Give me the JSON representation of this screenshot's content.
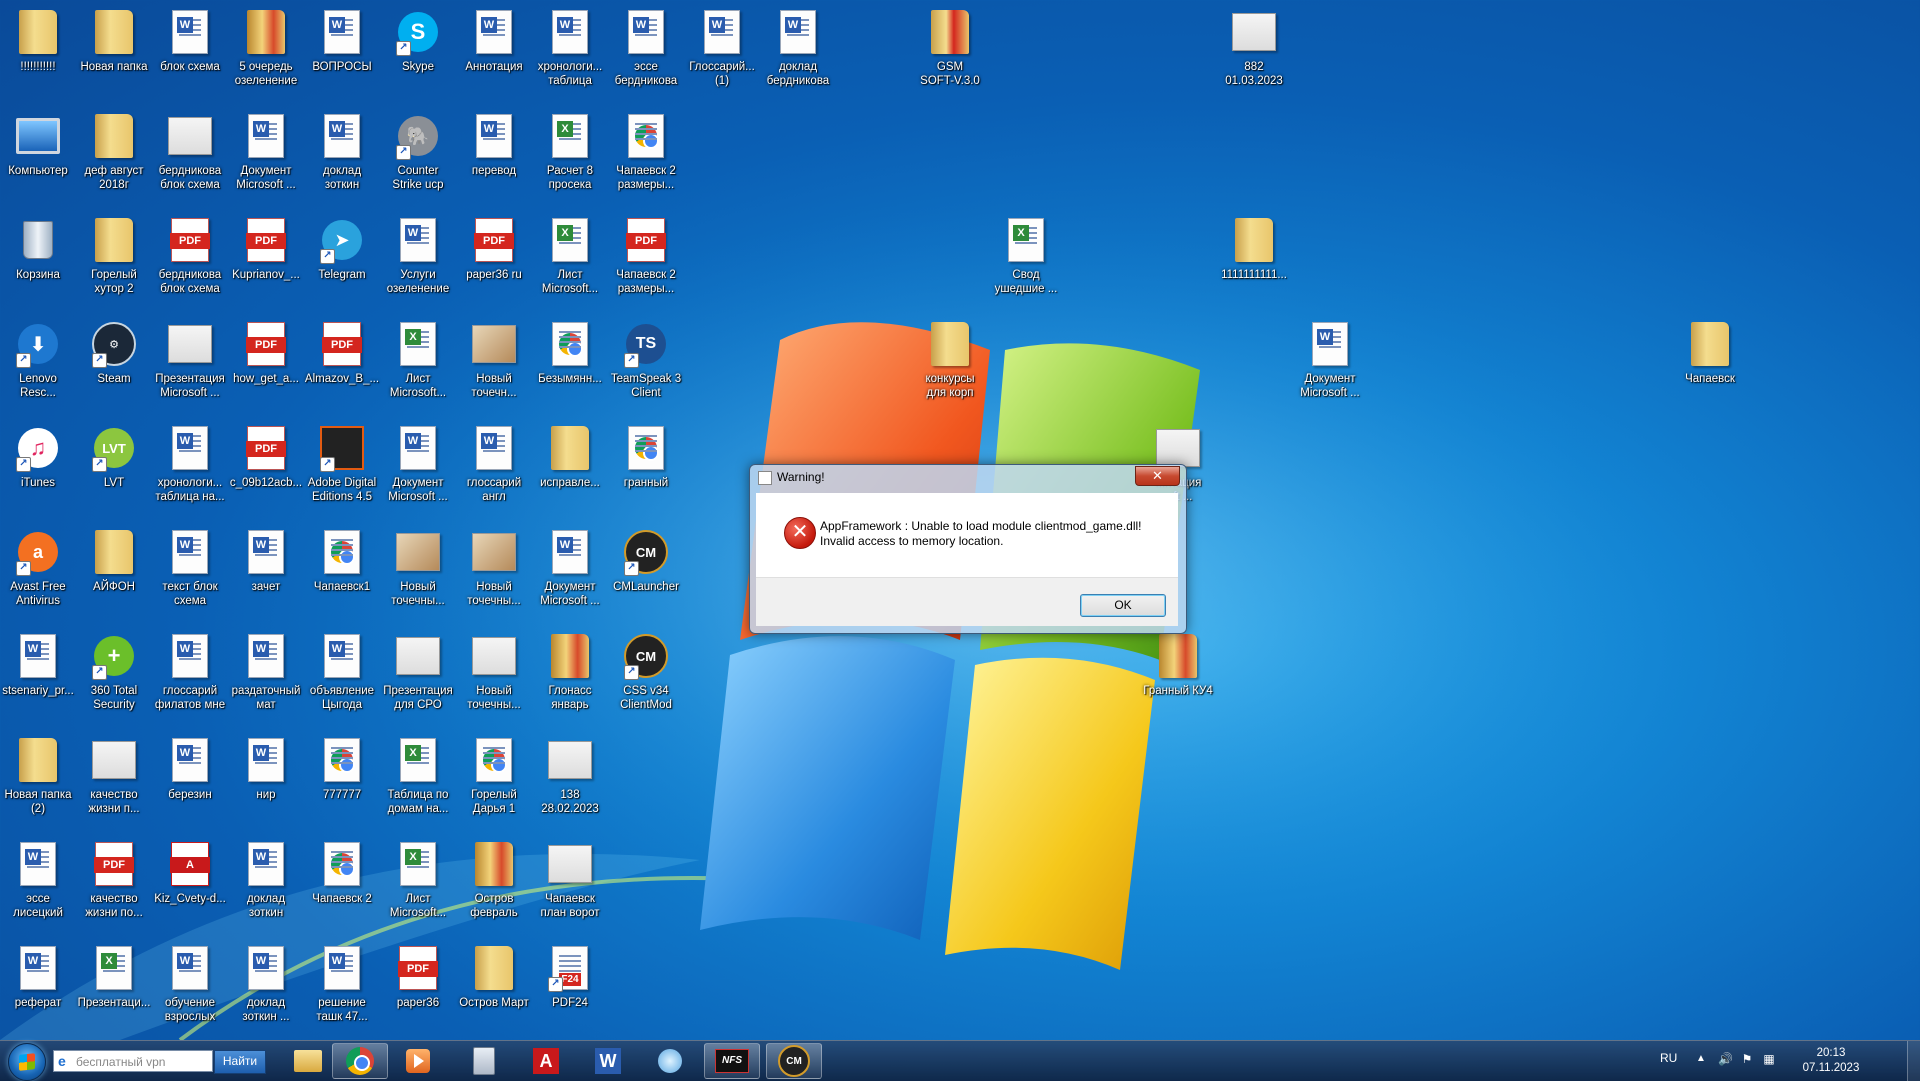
{
  "desktop": {
    "icons": [
      {
        "label": "!!!!!!!!!!!",
        "type": "folder"
      },
      {
        "label": "Новая папка",
        "type": "folder"
      },
      {
        "label": "блок схема",
        "type": "word"
      },
      {
        "label": "5 очередь\nозеленение",
        "type": "folder-red"
      },
      {
        "label": "ВОПРОСЫ",
        "type": "word"
      },
      {
        "label": "Skype",
        "type": "skype"
      },
      {
        "label": "Аннотация",
        "type": "word"
      },
      {
        "label": "хронологи...\nтаблица",
        "type": "word"
      },
      {
        "label": "эссе\nбердникова",
        "type": "word"
      },
      {
        "label": "Глоссарий...\n(1)",
        "type": "word"
      },
      {
        "label": "доклад\nбердникова",
        "type": "word"
      },
      {
        "label": "GSM\nSOFT-V.3.0",
        "type": "pdf-folder"
      },
      {
        "label": "882\n01.03.2023",
        "type": "image"
      },
      {
        "label": "Компьютер",
        "type": "computer"
      },
      {
        "label": "деф август\n2018г",
        "type": "folder"
      },
      {
        "label": "бердникова\nблок схема",
        "type": "image"
      },
      {
        "label": "Документ\nMicrosoft ...",
        "type": "word"
      },
      {
        "label": "доклад\nзоткин",
        "type": "word"
      },
      {
        "label": "Counter\nStrike ucp",
        "type": "elephant"
      },
      {
        "label": "перевод",
        "type": "word"
      },
      {
        "label": "Расчет 8\nпросека",
        "type": "excel"
      },
      {
        "label": "Чапаевск 2\nразмеры...",
        "type": "chrome"
      },
      {
        "label": "Корзина",
        "type": "bin"
      },
      {
        "label": "Горелый\nхутор 2",
        "type": "folder"
      },
      {
        "label": "бердникова\nблок схема",
        "type": "pdf"
      },
      {
        "label": "Kuprianov_...",
        "type": "pdf"
      },
      {
        "label": "Telegram",
        "type": "telegram"
      },
      {
        "label": "Услуги\nозеленение",
        "type": "word"
      },
      {
        "label": "paper36 ru",
        "type": "pdf"
      },
      {
        "label": "Лист\nMicrosoft...",
        "type": "excel"
      },
      {
        "label": "Чапаевск 2\nразмеры...",
        "type": "pdf"
      },
      {
        "label": "Свод\nушедшие ...",
        "type": "excel"
      },
      {
        "label": "1111111111...",
        "type": "folder"
      },
      {
        "label": "Lenovo\nResc...",
        "type": "lenovo"
      },
      {
        "label": "Steam",
        "type": "steam"
      },
      {
        "label": "Презентация\nMicrosoft ...",
        "type": "image"
      },
      {
        "label": "how_get_a...",
        "type": "pdf"
      },
      {
        "label": "Almazov_B_...",
        "type": "pdf"
      },
      {
        "label": "Лист\nMicrosoft...",
        "type": "excel"
      },
      {
        "label": "Новый\nточечн...",
        "type": "paint"
      },
      {
        "label": "Безымянн...",
        "type": "chrome"
      },
      {
        "label": "TeamSpeak 3\nClient",
        "type": "teamspeak"
      },
      {
        "label": "конкурсы\nдля корп",
        "type": "folder"
      },
      {
        "label": "Документ\nMicrosoft ...",
        "type": "word"
      },
      {
        "label": "Чапаевск",
        "type": "folder"
      },
      {
        "label": "iTunes",
        "type": "itunes"
      },
      {
        "label": "LVT",
        "type": "lvt"
      },
      {
        "label": "хронологи...\nтаблица на...",
        "type": "word"
      },
      {
        "label": "c_09b12acb...",
        "type": "pdf"
      },
      {
        "label": "Adobe Digital\nEditions 4.5",
        "type": "ade"
      },
      {
        "label": "Документ\nMicrosoft ...",
        "type": "word"
      },
      {
        "label": "глоссарий\nангл",
        "type": "word"
      },
      {
        "label": "исправле...",
        "type": "folder"
      },
      {
        "label": "гранный",
        "type": "chrome"
      },
      {
        "label": "...нтация\n...ft ...",
        "type": "image"
      },
      {
        "label": "Avast Free\nAntivirus",
        "type": "avast"
      },
      {
        "label": "АЙФОН",
        "type": "folder"
      },
      {
        "label": "текст блок\nсхема",
        "type": "word"
      },
      {
        "label": "зачет",
        "type": "word"
      },
      {
        "label": "Чапаевск1",
        "type": "chrome"
      },
      {
        "label": "Новый\nточечны...",
        "type": "paint"
      },
      {
        "label": "Новый\nточечны...",
        "type": "paint"
      },
      {
        "label": "Документ\nMicrosoft ...",
        "type": "word"
      },
      {
        "label": "CMLauncher",
        "type": "cm"
      },
      {
        "label": "stsenariy_pr...",
        "type": "word"
      },
      {
        "label": "360 Total\nSecurity",
        "type": "360"
      },
      {
        "label": "глоссарий\nфилатов мне",
        "type": "word"
      },
      {
        "label": "раздаточный\nмат",
        "type": "word"
      },
      {
        "label": "объявление\nЦыгода",
        "type": "word"
      },
      {
        "label": "Презентация\nдля СРО",
        "type": "image"
      },
      {
        "label": "Новый\nточечны...",
        "type": "image"
      },
      {
        "label": "Глонасс\nянварь",
        "type": "folder-red"
      },
      {
        "label": "CSS v34\nClientMod",
        "type": "cm"
      },
      {
        "label": "Гранный КУ4",
        "type": "folder-red"
      },
      {
        "label": "Новая папка\n(2)",
        "type": "folder"
      },
      {
        "label": "качество\nжизни п...",
        "type": "image"
      },
      {
        "label": "березин",
        "type": "word"
      },
      {
        "label": "нир",
        "type": "word"
      },
      {
        "label": "777777",
        "type": "chrome"
      },
      {
        "label": "Таблица по\nдомам на...",
        "type": "excel"
      },
      {
        "label": "Горелый\nДарья 1",
        "type": "chrome"
      },
      {
        "label": "138\n28.02.2023",
        "type": "image"
      },
      {
        "label": "эссе\nлисецкий",
        "type": "word"
      },
      {
        "label": "качество\nжизни по...",
        "type": "pdf"
      },
      {
        "label": "Kiz_Cvety-d...",
        "type": "acrobat"
      },
      {
        "label": "доклад\nзоткин",
        "type": "word"
      },
      {
        "label": "Чапаевск 2",
        "type": "chrome"
      },
      {
        "label": "Лист\nMicrosoft...",
        "type": "excel"
      },
      {
        "label": "Остров\nфевраль",
        "type": "folder-red"
      },
      {
        "label": "Чапаевск\nплан ворот",
        "type": "image"
      },
      {
        "label": "реферат",
        "type": "word"
      },
      {
        "label": "Презентаци...",
        "type": "excel"
      },
      {
        "label": "обучение\nвзрослых",
        "type": "word"
      },
      {
        "label": "доклад\nзоткин ...",
        "type": "word"
      },
      {
        "label": "решение\nташк 47...",
        "type": "word"
      },
      {
        "label": "paper36",
        "type": "pdf"
      },
      {
        "label": "Остров Март",
        "type": "folder"
      },
      {
        "label": "PDF24",
        "type": "pdf24"
      }
    ]
  },
  "dialog": {
    "title": "Warning!",
    "close_glyph": "✕",
    "message_line1": "AppFramework : Unable to load module clientmod_game.dll!",
    "message_line2": "Invalid access to memory location.",
    "ok_label": "OK",
    "error_glyph": "✕"
  },
  "taskbar": {
    "search_placeholder": "бесплатный vpn",
    "search_button": "Найти",
    "pinned": [
      {
        "name": "explorer"
      },
      {
        "name": "chrome"
      },
      {
        "name": "media-player"
      },
      {
        "name": "calculator"
      },
      {
        "name": "adobe-reader"
      },
      {
        "name": "word"
      },
      {
        "name": "speaker"
      },
      {
        "name": "nfs"
      },
      {
        "name": "cmlauncher"
      }
    ],
    "tray": {
      "language": "RU",
      "time": "20:13",
      "date": "07.11.2023"
    }
  },
  "colors": {
    "desktop_blue": "#1283d2",
    "taskbar": "#1a365e",
    "error_red": "#c4190c"
  }
}
